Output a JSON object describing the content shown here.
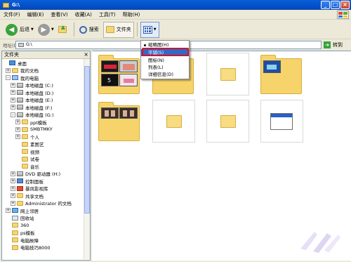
{
  "window": {
    "title": "G:\\",
    "min_label": "_",
    "max_label": "□",
    "close_label": "×"
  },
  "menu": [
    "文件(F)",
    "编辑(E)",
    "查看(V)",
    "收藏(A)",
    "工具(T)",
    "帮助(H)"
  ],
  "toolbar": {
    "back": "后退",
    "search": "搜索",
    "folders": "文件夹"
  },
  "address": {
    "label": "地址(D)",
    "value": "G:\\",
    "go": "转到"
  },
  "leftpane": {
    "title": "文件夹",
    "close": "×",
    "tree": [
      {
        "label": "桌面",
        "exp": "",
        "icon": "desk"
      },
      {
        "label": "我的文档",
        "exp": "+",
        "icon": "fold"
      },
      {
        "label": "我的电脑",
        "exp": "-",
        "icon": "pc"
      },
      {
        "label": "本地磁盘 (C:)",
        "exp": "+",
        "icon": "disk"
      },
      {
        "label": "本地磁盘 (D:)",
        "exp": "+",
        "icon": "disk"
      },
      {
        "label": "本地磁盘 (E:)",
        "exp": "+",
        "icon": "disk"
      },
      {
        "label": "本地磁盘 (F:)",
        "exp": "+",
        "icon": "disk"
      },
      {
        "label": "本地磁盘 (G:)",
        "exp": "-",
        "icon": "disk"
      },
      {
        "label": "ppt模板",
        "exp": "+",
        "icon": "fold"
      },
      {
        "label": "SMBTMKY",
        "exp": "+",
        "icon": "fold"
      },
      {
        "label": "个人",
        "exp": "+",
        "icon": "fold"
      },
      {
        "label": "素图艺",
        "exp": "",
        "icon": "fold"
      },
      {
        "label": "视频",
        "exp": "",
        "icon": "fold"
      },
      {
        "label": "试卷",
        "exp": "",
        "icon": "fold"
      },
      {
        "label": "音乐",
        "exp": "",
        "icon": "fold"
      },
      {
        "label": "DVD 驱动器 (H:)",
        "exp": "+",
        "icon": "disk"
      },
      {
        "label": "控制面板",
        "exp": "+",
        "icon": "ctrlico"
      },
      {
        "label": "暴风影视库",
        "exp": "+",
        "icon": "redico"
      },
      {
        "label": "共享文档",
        "exp": "+",
        "icon": "fold"
      },
      {
        "label": "Administrator 的文档",
        "exp": "+",
        "icon": "fold"
      },
      {
        "label": "网上邻居",
        "exp": "+",
        "icon": "netico"
      },
      {
        "label": "回收站",
        "exp": "",
        "icon": "binico"
      },
      {
        "label": "360",
        "exp": "",
        "icon": "fold"
      },
      {
        "label": "ps模板",
        "exp": "",
        "icon": "fold"
      },
      {
        "label": "电脑故障",
        "exp": "",
        "icon": "fold"
      },
      {
        "label": "电脑技巧8000",
        "exp": "",
        "icon": "fold"
      }
    ]
  },
  "viewmenu": {
    "items": [
      "缩略图(H)",
      "平铺(S)",
      "图标(N)",
      "列表(L)",
      "详细信息(D)"
    ],
    "selected": "平铺(S)",
    "checked": "缩略图(H)"
  },
  "colors": {
    "titlebar": "#0450c8",
    "highlight": "#316ac5",
    "red_box": "#d8102a",
    "folder": "#f6d46b"
  }
}
